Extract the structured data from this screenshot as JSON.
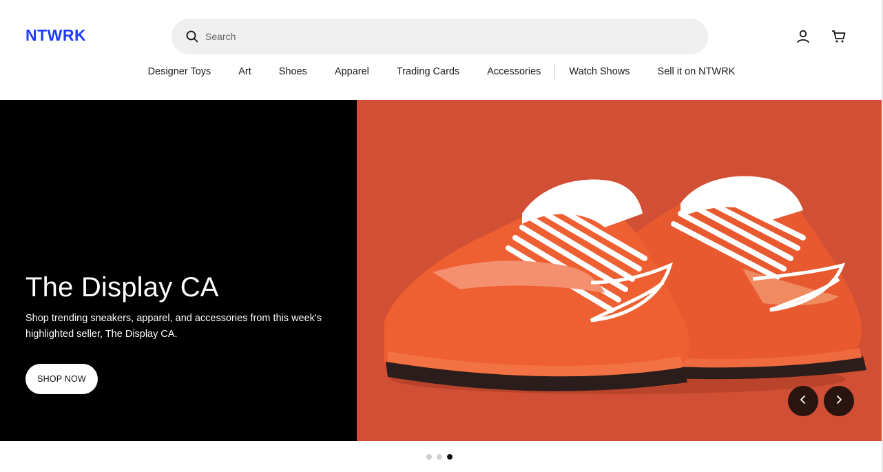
{
  "header": {
    "logo_text": "NTWRK",
    "search_placeholder": "Search",
    "search_value": ""
  },
  "nav": {
    "items": [
      {
        "label": "Designer Toys"
      },
      {
        "label": "Art"
      },
      {
        "label": "Shoes"
      },
      {
        "label": "Apparel"
      },
      {
        "label": "Trading Cards"
      },
      {
        "label": "Accessories"
      },
      {
        "label": "Watch Shows"
      },
      {
        "label": "Sell it on NTWRK"
      }
    ]
  },
  "hero": {
    "title": "The Display CA",
    "subtitle": "Shop trending sneakers, apparel, and accessories from this week's highlighted seller, The Display CA.",
    "cta_label": "SHOP NOW",
    "image_icon": "orange-sneakers-image",
    "slides_count": 3,
    "active_slide": 3
  },
  "icons": {
    "search": "search-icon",
    "account": "user-icon",
    "cart": "cart-icon",
    "prev": "chevron-left-icon",
    "next": "chevron-right-icon"
  },
  "colors": {
    "brand": "#1f3bff",
    "hero_left_bg": "#000000",
    "hero_right_bg": "#d14f34",
    "arrow_bg": "#2a140f"
  }
}
